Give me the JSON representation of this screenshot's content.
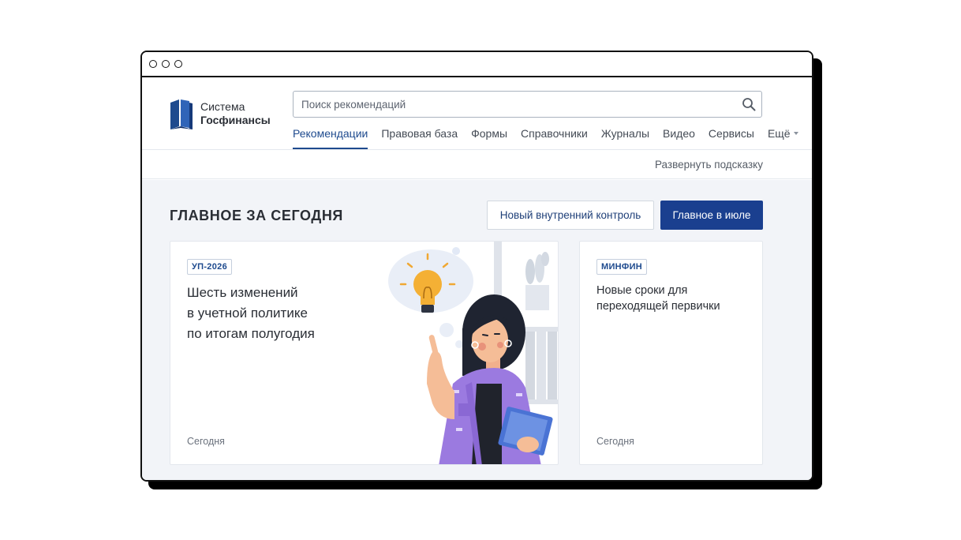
{
  "app": {
    "logo": {
      "line1": "Система",
      "line2": "Госфинансы"
    }
  },
  "search": {
    "placeholder": "Поиск рекомендаций"
  },
  "nav": {
    "items": [
      {
        "label": "Рекомендации",
        "active": true
      },
      {
        "label": "Правовая база",
        "active": false
      },
      {
        "label": "Формы",
        "active": false
      },
      {
        "label": "Справочники",
        "active": false
      },
      {
        "label": "Журналы",
        "active": false
      },
      {
        "label": "Видео",
        "active": false
      },
      {
        "label": "Сервисы",
        "active": false
      }
    ],
    "more_label": "Ещё"
  },
  "hint": {
    "expand_label": "Развернуть подсказку"
  },
  "main": {
    "section_title": "ГЛАВНОЕ ЗА СЕГОДНЯ",
    "buttons": {
      "internal_control": "Новый внутренний контроль",
      "july_main": "Главное в июле"
    },
    "cards": [
      {
        "tag": "УП-2026",
        "title_lines": [
          "Шесть изменений",
          "в учетной политике",
          "по итогам полугодия"
        ],
        "date": "Сегодня"
      },
      {
        "tag": "МИНФИН",
        "title": "Новые сроки для переходящей первички",
        "date": "Сегодня"
      }
    ]
  },
  "colors": {
    "brand_blue": "#1a3f8f",
    "link_blue": "#1e4a8e",
    "background": "#f2f4f8"
  },
  "icons": [
    "book-logo-icon",
    "search-icon",
    "chevron-down-icon",
    "lightbulb-icon"
  ]
}
